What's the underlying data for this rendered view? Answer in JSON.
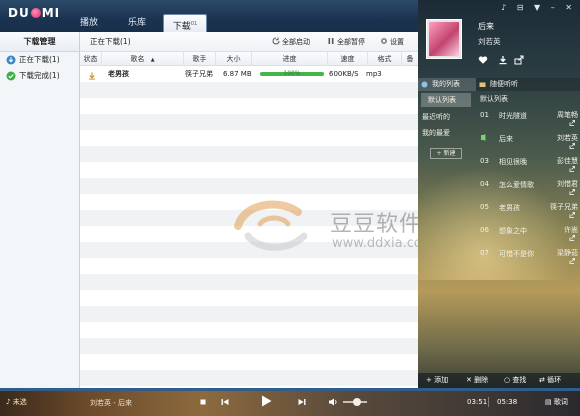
{
  "app": {
    "logo_left": "DU",
    "logo_right": "MI"
  },
  "nav": {
    "tabs": [
      {
        "label": "播放"
      },
      {
        "label": "乐库"
      },
      {
        "label": "下载",
        "badge": "01"
      }
    ]
  },
  "sidebar": {
    "title": "下载管理",
    "items": [
      {
        "label": "正在下载(1)",
        "icon": "downloading-icon",
        "color": "#3a85c7"
      },
      {
        "label": "下载完成(1)",
        "icon": "check-circle-icon",
        "color": "#3fae49"
      }
    ]
  },
  "toolbar": {
    "title": "正在下载(1)",
    "start_all": "全部启动",
    "pause_all": "全部暂停",
    "settings": "设置"
  },
  "table": {
    "columns": [
      "状态",
      "歌名",
      "歌手",
      "大小",
      "进度",
      "速度",
      "格式",
      "备"
    ],
    "rows": [
      {
        "status_icon": "downloading-arrow-icon",
        "title": "老男孩",
        "artist": "筷子兄弟",
        "size": "6.87 MB",
        "progress": 1.0,
        "progress_label": "100%",
        "speed": "600KB/S",
        "format": "mp3"
      }
    ]
  },
  "watermark": {
    "text_cn": "豆豆软件站",
    "url": "www.ddxia.com"
  },
  "window_controls": {
    "labels": "♪ ⊟ ▼ – ✕"
  },
  "now_playing": {
    "title": "后来",
    "artist": "刘若英"
  },
  "right_tabs": {
    "my_list": "我的列表",
    "hot_list": "随便听听"
  },
  "playlists": {
    "items": [
      "默认列表",
      "最近听的",
      "我的最爱"
    ],
    "new_button": "新建"
  },
  "songs": {
    "list_title": "默认列表",
    "items": [
      {
        "num": "01",
        "name": "时光隧道",
        "artist": "周笔畅"
      },
      {
        "num": "",
        "name": "后来",
        "artist": "刘若英",
        "playing": true
      },
      {
        "num": "03",
        "name": "相见很晚",
        "artist": "彭佳慧"
      },
      {
        "num": "04",
        "name": "怎么爱情歌",
        "artist": "刘惜君"
      },
      {
        "num": "05",
        "name": "老男孩",
        "artist": "筷子兄弟"
      },
      {
        "num": "06",
        "name": "想象之中",
        "artist": "许嵩"
      },
      {
        "num": "07",
        "name": "可惜不是你",
        "artist": "梁静茹"
      }
    ]
  },
  "list_footer": {
    "add": "添加",
    "delete": "删除",
    "find": "查找",
    "loop": "循环"
  },
  "player": {
    "brand": "未选",
    "track": "刘若英 - 后来",
    "current_time": "03:51",
    "total_time": "05:38",
    "lyrics": "歌词",
    "progress": 0.0,
    "volume": 0.6
  },
  "colors": {
    "accent": "#2f5e8c",
    "progress_green": "#43b649",
    "titlebar": "#1b3350"
  }
}
